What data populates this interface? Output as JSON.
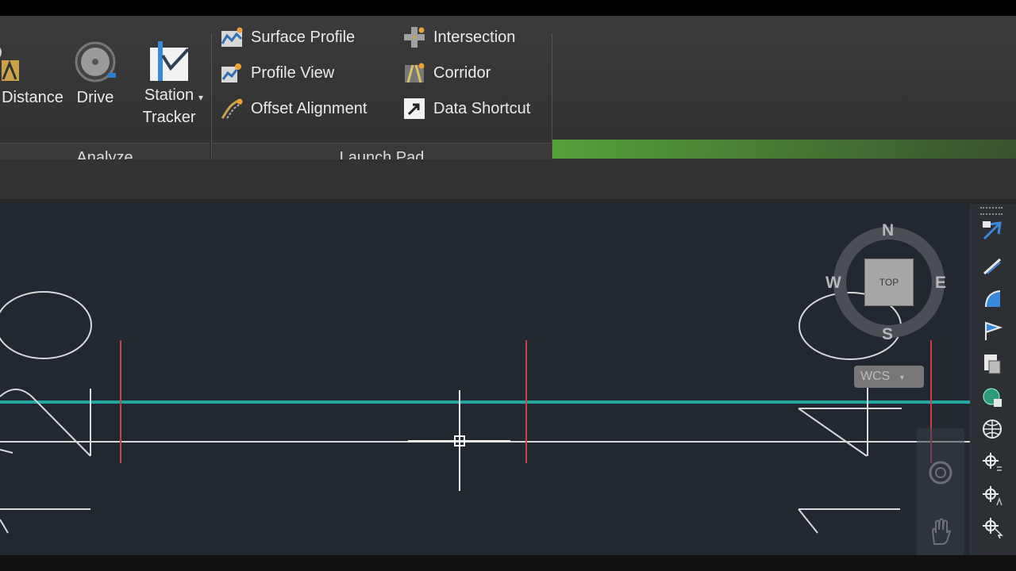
{
  "ribbon": {
    "analyze": {
      "label": "Analyze",
      "distance_label": "Distance",
      "drive_label": "Drive",
      "station_tracker_line1": "Station",
      "station_tracker_line2": "Tracker"
    },
    "launchpad": {
      "label": "Launch Pad",
      "items": [
        {
          "label": "Surface Profile"
        },
        {
          "label": "Profile View"
        },
        {
          "label": "Offset Alignment"
        },
        {
          "label": "Intersection"
        },
        {
          "label": "Corridor"
        },
        {
          "label": "Data Shortcut"
        }
      ]
    }
  },
  "viewcube": {
    "face": "TOP",
    "north": "N",
    "south": "S",
    "east": "E",
    "west": "W",
    "ucs": "WCS"
  },
  "colors": {
    "accent_green": "#5cb43c",
    "viewport_bg": "#212830",
    "red_line": "#c8424a",
    "cyan_line": "#24a7a0"
  }
}
